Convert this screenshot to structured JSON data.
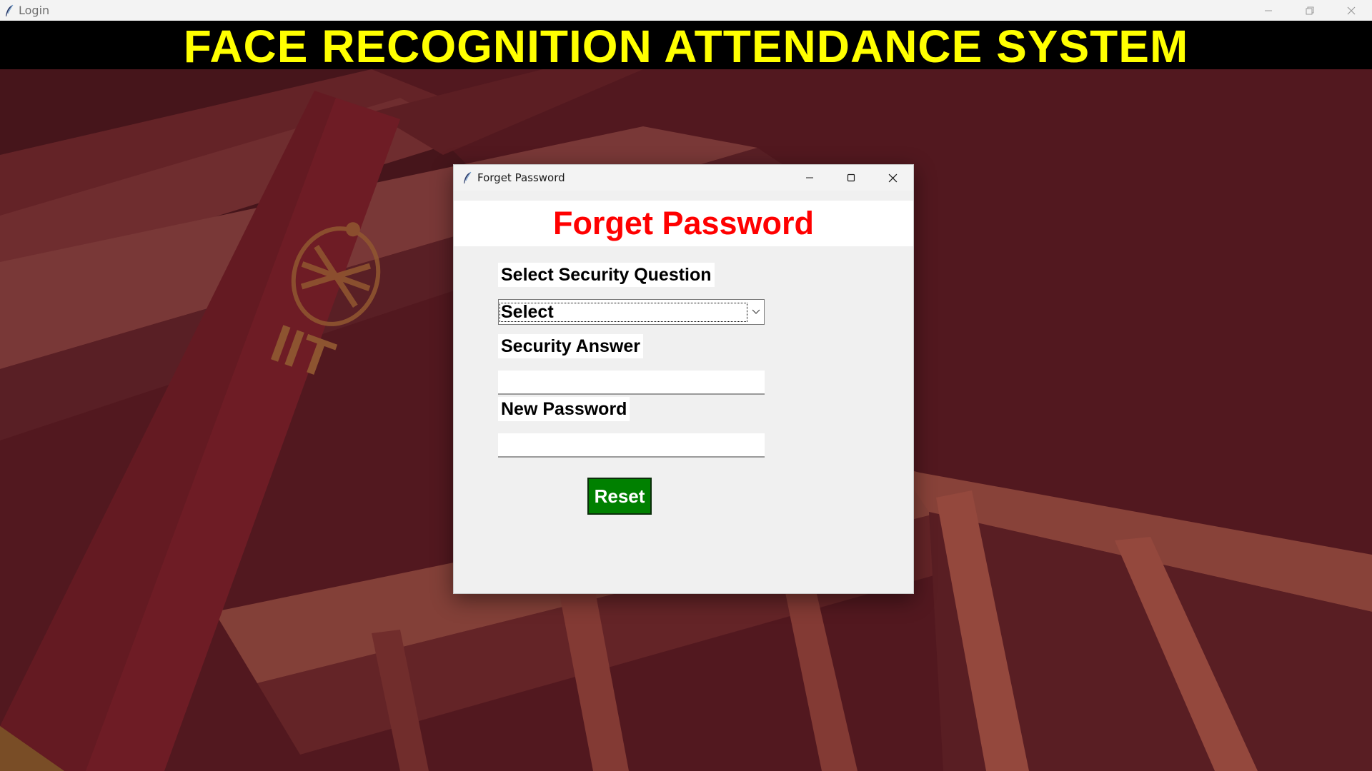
{
  "window": {
    "title": "Login",
    "controls": {
      "minimize": "minimize-icon",
      "restore": "restore-icon",
      "close": "close-icon"
    }
  },
  "banner": {
    "title": "FACE RECOGNITION ATTENDANCE SYSTEM",
    "text_color": "#ffff00",
    "background": "#000000"
  },
  "background": {
    "banner_text": "IIT"
  },
  "dialog": {
    "window_title": "Forget Password",
    "heading": "Forget Password",
    "heading_color": "#ff0000",
    "security_question": {
      "label": "Select Security Question",
      "selected": "Select",
      "options": [
        "Select"
      ]
    },
    "security_answer": {
      "label": "Security Answer",
      "value": ""
    },
    "new_password": {
      "label": "New Password",
      "value": ""
    },
    "reset_button": {
      "label": "Reset",
      "color": "#008000"
    }
  }
}
